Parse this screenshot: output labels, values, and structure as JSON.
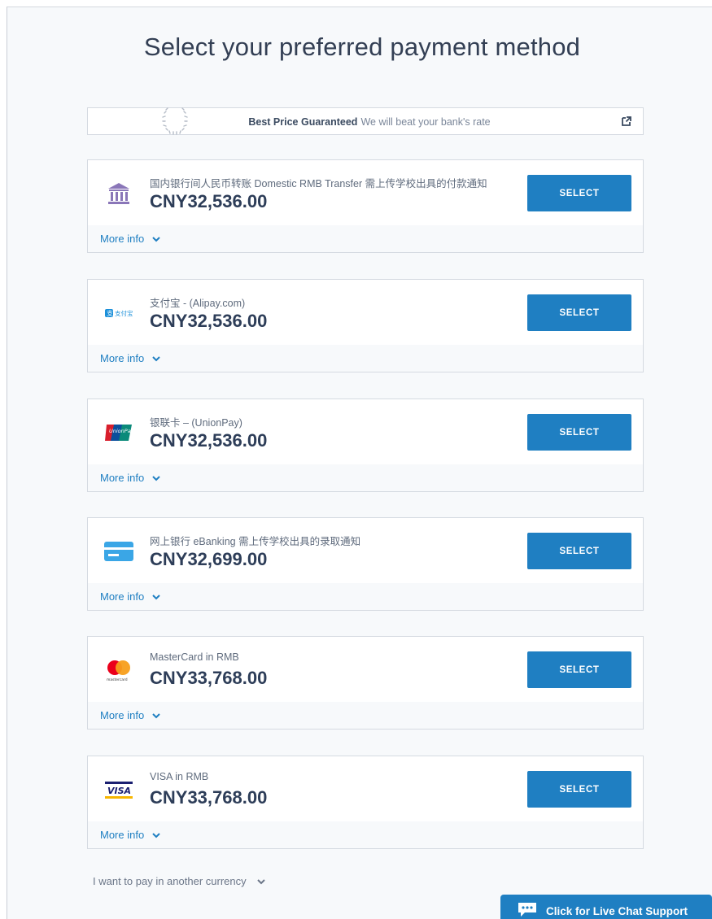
{
  "page": {
    "title": "Select your preferred payment method"
  },
  "promo": {
    "bold": "Best Price Guaranteed",
    "text": "We will beat your bank's rate"
  },
  "methods": [
    {
      "name": "国内银行间人民币转账 Domestic RMB Transfer 需上传学校出具的付款通知",
      "price": "CNY32,536.00",
      "button": "SELECT",
      "more": "More info",
      "icon": "bank-icon"
    },
    {
      "name": "支付宝 - (Alipay.com)",
      "price": "CNY32,536.00",
      "button": "SELECT",
      "more": "More info",
      "icon": "alipay-icon",
      "logo_text": "支付宝"
    },
    {
      "name": "银联卡 – (UnionPay)",
      "price": "CNY32,536.00",
      "button": "SELECT",
      "more": "More info",
      "icon": "unionpay-icon",
      "logo_text": "UnionPay"
    },
    {
      "name": "网上银行 eBanking 需上传学校出具的录取通知",
      "price": "CNY32,699.00",
      "button": "SELECT",
      "more": "More info",
      "icon": "card-icon"
    },
    {
      "name": "MasterCard in RMB",
      "price": "CNY33,768.00",
      "button": "SELECT",
      "more": "More info",
      "icon": "mastercard-icon",
      "logo_text": "mastercard"
    },
    {
      "name": "VISA in RMB",
      "price": "CNY33,768.00",
      "button": "SELECT",
      "more": "More info",
      "icon": "visa-icon",
      "logo_text": "VISA"
    }
  ],
  "footer": {
    "currency_link": "I want to pay in another currency"
  },
  "chat": {
    "label": "Click for Live Chat Support",
    "icon": "chat-bubble-icon"
  },
  "colors": {
    "accent": "#1f7fc2",
    "background": "#f7f9fb",
    "text": "#2d3d58"
  }
}
